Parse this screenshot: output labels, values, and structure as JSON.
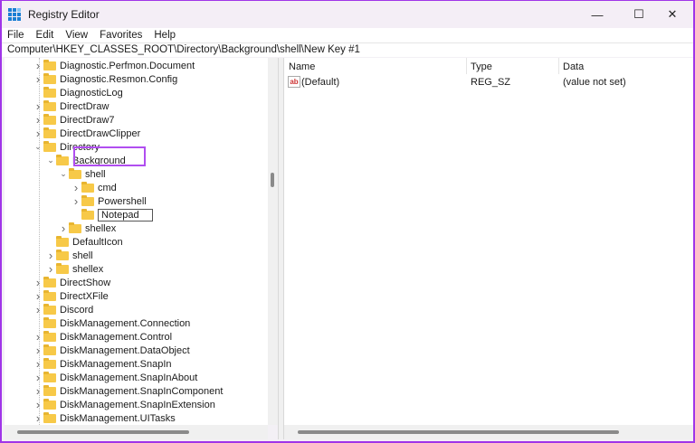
{
  "window": {
    "title": "Registry Editor",
    "minimize": "—",
    "maximize": "☐",
    "close": "✕"
  },
  "menu": [
    "File",
    "Edit",
    "View",
    "Favorites",
    "Help"
  ],
  "address": "Computer\\HKEY_CLASSES_ROOT\\Directory\\Background\\shell\\New Key #1",
  "tree": [
    {
      "label": "Diagnostic.Perfmon.Document",
      "level": 0,
      "state": "collapsed"
    },
    {
      "label": "Diagnostic.Resmon.Config",
      "level": 0,
      "state": "collapsed"
    },
    {
      "label": "DiagnosticLog",
      "level": 0,
      "state": "leaf"
    },
    {
      "label": "DirectDraw",
      "level": 0,
      "state": "collapsed"
    },
    {
      "label": "DirectDraw7",
      "level": 0,
      "state": "collapsed"
    },
    {
      "label": "DirectDrawClipper",
      "level": 0,
      "state": "collapsed"
    },
    {
      "label": "Directory",
      "level": 0,
      "state": "expanded"
    },
    {
      "label": "Background",
      "level": 1,
      "state": "expanded"
    },
    {
      "label": "shell",
      "level": 2,
      "state": "expanded"
    },
    {
      "label": "cmd",
      "level": 3,
      "state": "collapsed"
    },
    {
      "label": "Powershell",
      "level": 3,
      "state": "collapsed"
    },
    {
      "label": "Notepad",
      "level": 3,
      "state": "editing"
    },
    {
      "label": "shellex",
      "level": 2,
      "state": "collapsed"
    },
    {
      "label": "DefaultIcon",
      "level": 1,
      "state": "leaf"
    },
    {
      "label": "shell",
      "level": 1,
      "state": "collapsed"
    },
    {
      "label": "shellex",
      "level": 1,
      "state": "collapsed"
    },
    {
      "label": "DirectShow",
      "level": 0,
      "state": "collapsed"
    },
    {
      "label": "DirectXFile",
      "level": 0,
      "state": "collapsed"
    },
    {
      "label": "Discord",
      "level": 0,
      "state": "collapsed"
    },
    {
      "label": "DiskManagement.Connection",
      "level": 0,
      "state": "leaf"
    },
    {
      "label": "DiskManagement.Control",
      "level": 0,
      "state": "collapsed"
    },
    {
      "label": "DiskManagement.DataObject",
      "level": 0,
      "state": "collapsed"
    },
    {
      "label": "DiskManagement.SnapIn",
      "level": 0,
      "state": "collapsed"
    },
    {
      "label": "DiskManagement.SnapInAbout",
      "level": 0,
      "state": "collapsed"
    },
    {
      "label": "DiskManagement.SnapInComponent",
      "level": 0,
      "state": "collapsed"
    },
    {
      "label": "DiskManagement.SnapInExtension",
      "level": 0,
      "state": "collapsed"
    },
    {
      "label": "DiskManagement.UITasks",
      "level": 0,
      "state": "collapsed"
    }
  ],
  "values": {
    "columns": [
      "Name",
      "Type",
      "Data"
    ],
    "rows": [
      {
        "icon": "ab",
        "name": "(Default)",
        "type": "REG_SZ",
        "data": "(value not set)"
      }
    ]
  },
  "colors": {
    "highlight": "#b04ef0",
    "folder": "#f7c948"
  }
}
